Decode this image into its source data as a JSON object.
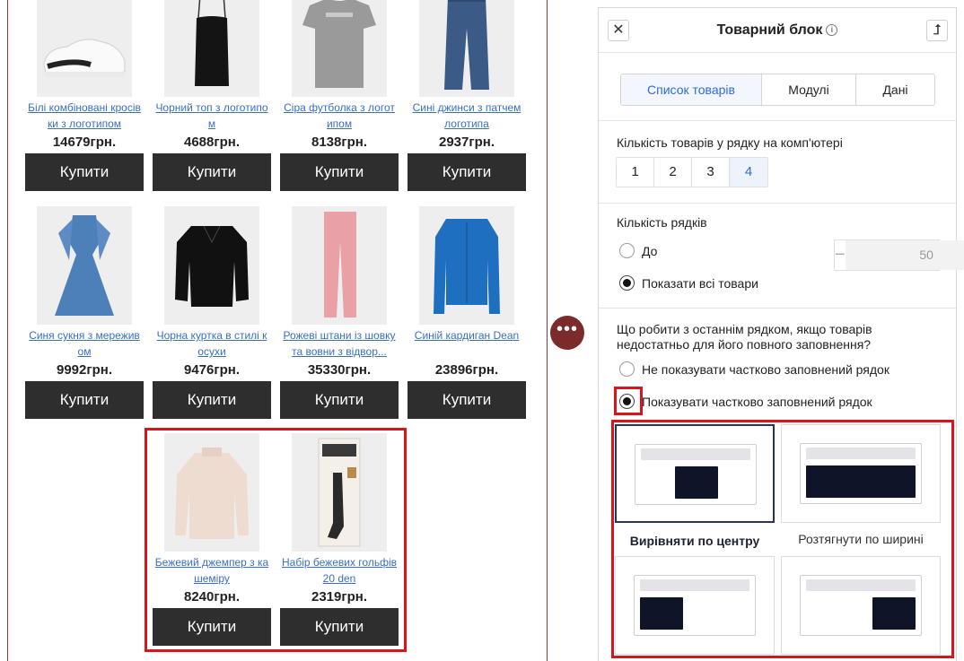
{
  "products": [
    {
      "name": "Білі комбіновані кросівки з логотипом",
      "price": "14679грн.",
      "buy": "Купити",
      "icon": "sneaker-image"
    },
    {
      "name": "Чорний топ з логотипом",
      "price": "4688грн.",
      "buy": "Купити",
      "icon": "black-top-image"
    },
    {
      "name": "Сіра футболка з логотипом",
      "price": "8138грн.",
      "buy": "Купити",
      "icon": "gray-tshirt-image"
    },
    {
      "name": "Сині джинси з патчем логотипа",
      "price": "2937грн.",
      "buy": "Купити",
      "icon": "blue-jeans-image"
    },
    {
      "name": "Синя сукня з мереживом",
      "price": "9992грн.",
      "buy": "Купити",
      "icon": "blue-dress-image"
    },
    {
      "name": "Чорна куртка в стилі косухи",
      "price": "9476грн.",
      "buy": "Купити",
      "icon": "leather-jacket-image"
    },
    {
      "name": "Рожеві штани із шовку та вовни з відвор...",
      "price": "35330грн.",
      "buy": "Купити",
      "icon": "pink-trousers-image"
    },
    {
      "name": "Синій кардиган Dean",
      "price": "23896грн.",
      "buy": "Купити",
      "icon": "blue-cardigan-image"
    },
    {
      "name": "Бежевий джемпер з кашеміру",
      "price": "8240грн.",
      "buy": "Купити",
      "icon": "beige-sweater-image"
    },
    {
      "name": "Набір бежевих гольфів 20 den",
      "price": "2319грн.",
      "buy": "Купити",
      "icon": "stockings-pack-image"
    }
  ],
  "panel": {
    "title": "Товарний блок",
    "close_icon": "close-icon",
    "info_icon": "info-icon",
    "collapse_icon": "arrow-up-icon",
    "tabs": [
      {
        "label": "Список товарів",
        "active": true
      },
      {
        "label": "Модулі",
        "active": false
      },
      {
        "label": "Дані",
        "active": false
      }
    ],
    "per_row": {
      "label": "Кількість товарів у рядку на комп'ютері",
      "options": [
        "1",
        "2",
        "3",
        "4"
      ],
      "selected": "4"
    },
    "rows": {
      "label": "Кількість рядків",
      "option_upto": "До",
      "option_all": "Показати всі товари",
      "selected": "all",
      "stepper_value": "50",
      "minus": "−",
      "plus": "+"
    },
    "last_row": {
      "question": "Що робити з останнім рядком, якщо товарів недостатньо для його повного заповнення?",
      "option_hide": "Не показувати частково заповнений рядок",
      "option_show": "Показувати частково заповнений рядок",
      "selected": "show"
    },
    "alignment": {
      "options": [
        {
          "label": "Вирівняти по центру",
          "selected": true
        },
        {
          "label": "Розтягнути по ширині",
          "selected": false
        },
        {
          "label": "",
          "selected": false
        },
        {
          "label": "",
          "selected": false
        }
      ]
    }
  },
  "more_button": "•••",
  "colors": {
    "accent": "#2f6bd8",
    "highlight": "#d8141c",
    "buy_button": "#2e2e2e",
    "more_button": "#7b2b2b"
  }
}
